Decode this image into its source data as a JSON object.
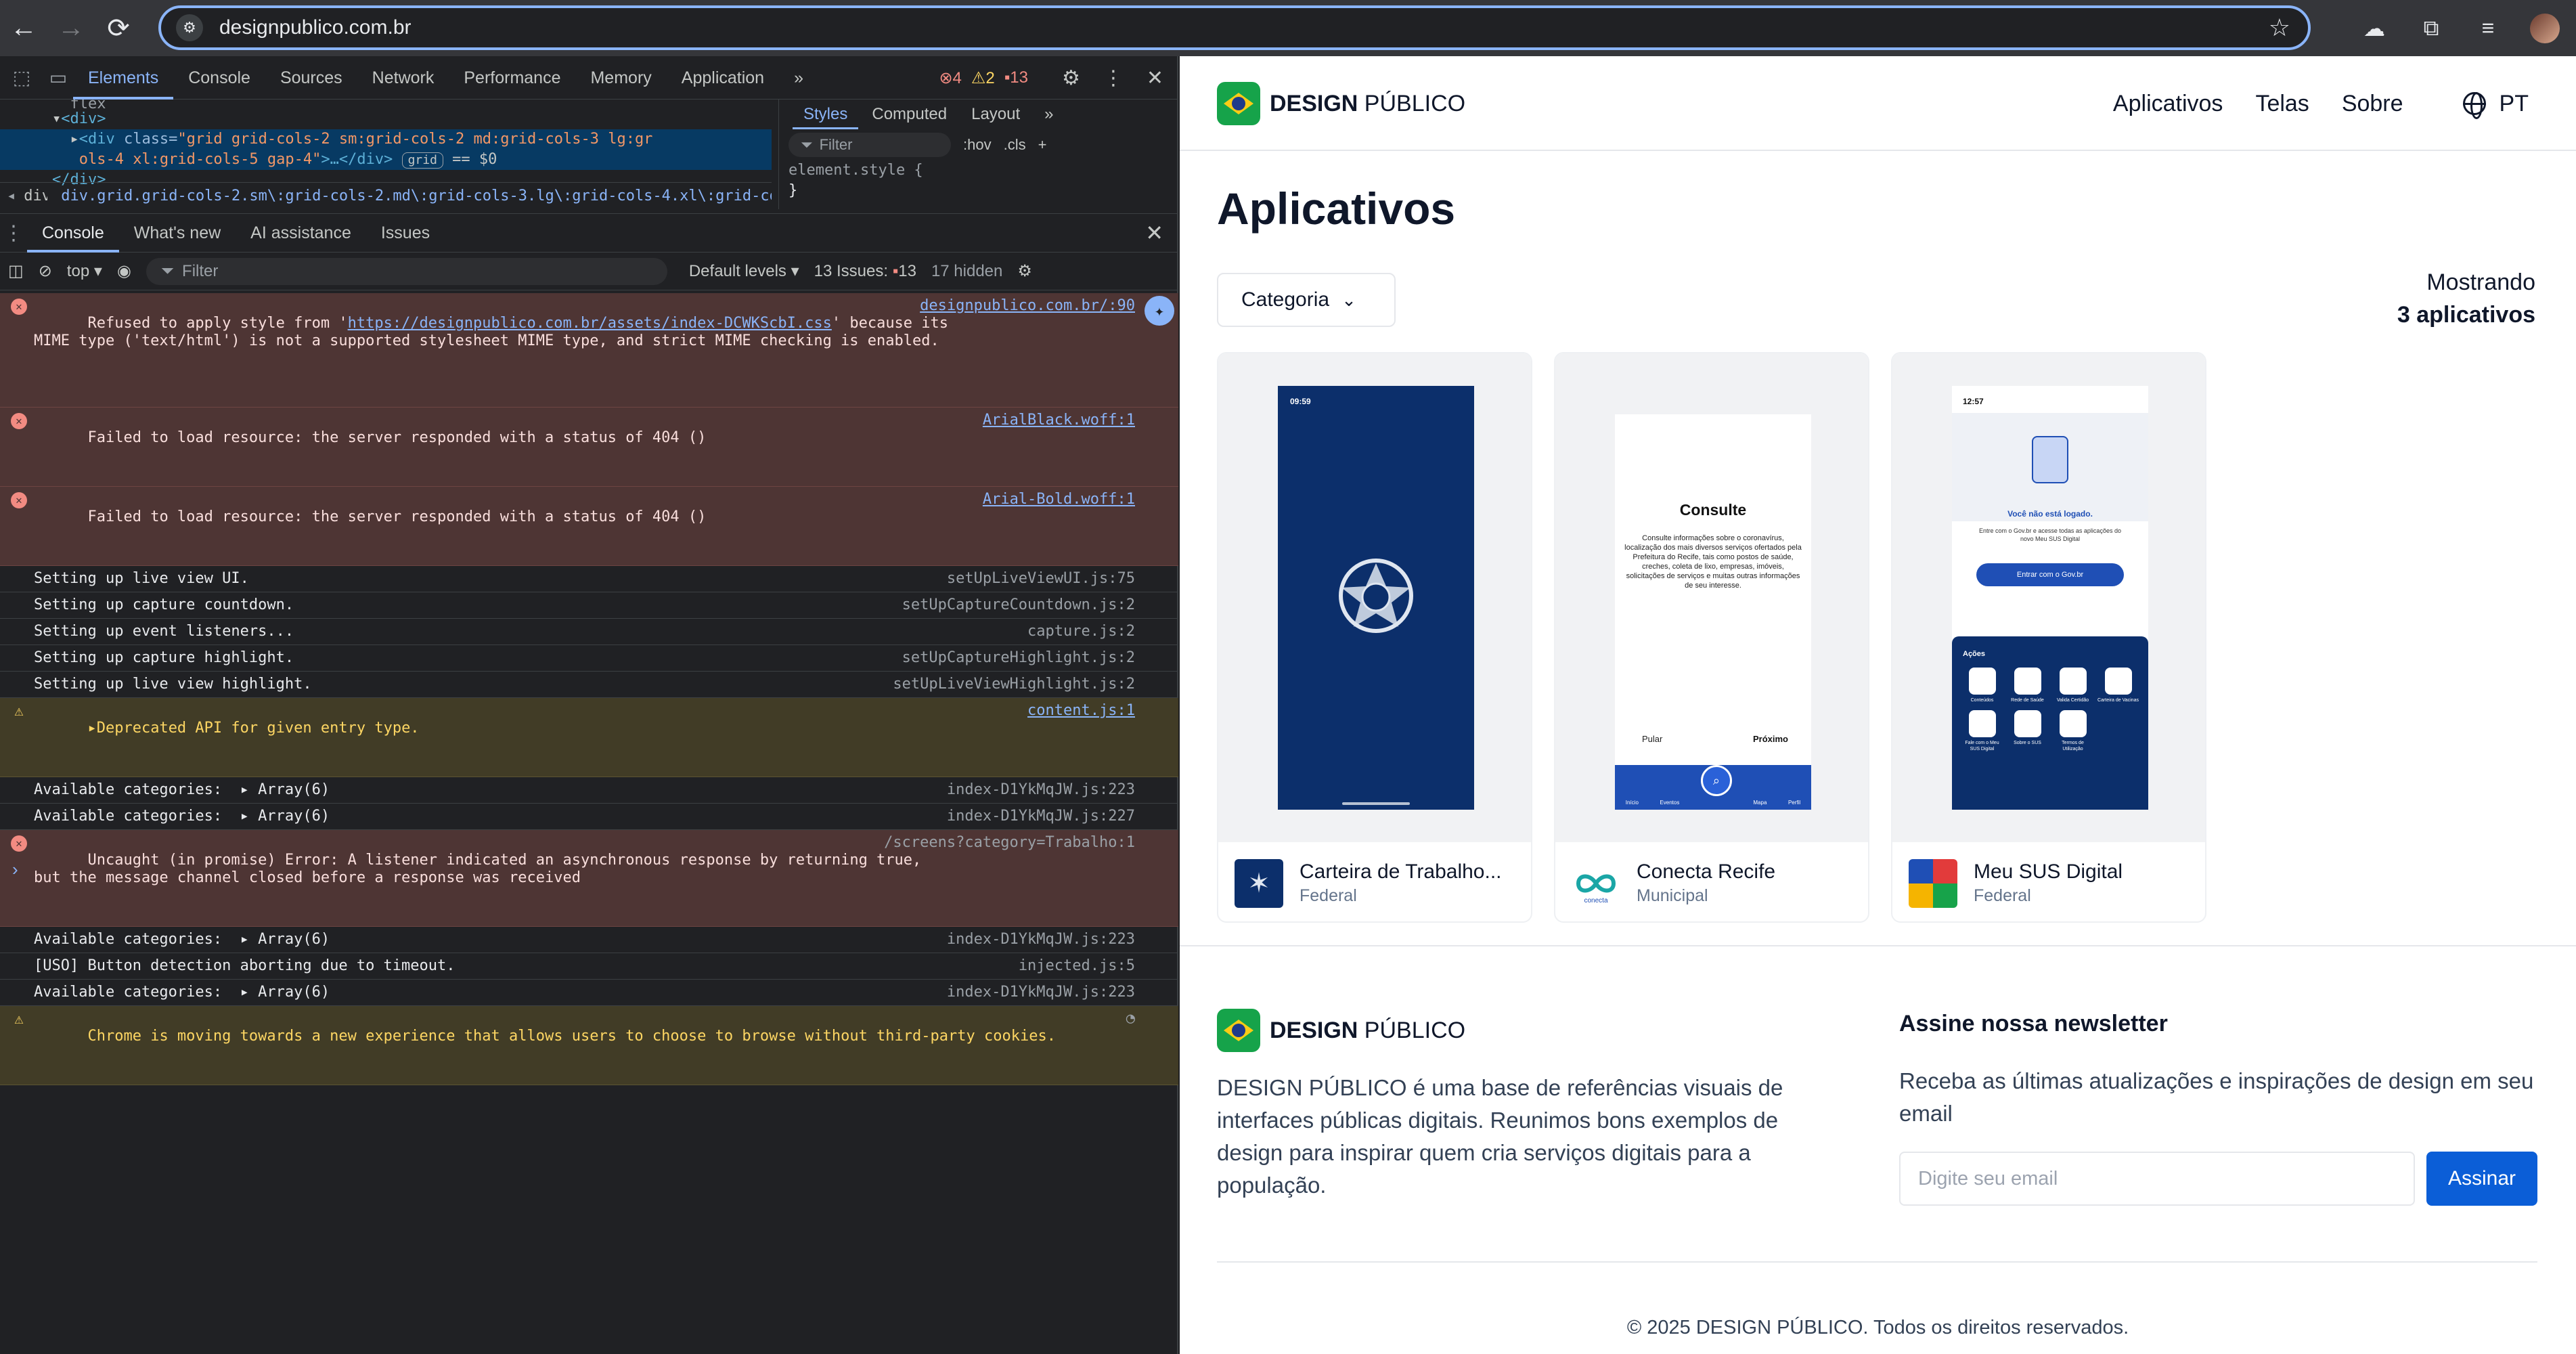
{
  "browser": {
    "url": "designpublico.com.br",
    "icons": [
      "back-icon",
      "forward-icon",
      "reload-icon",
      "site-info-icon",
      "star-icon",
      "cloud-icon",
      "extensions-icon",
      "media-icon",
      "profile-avatar"
    ]
  },
  "devtools": {
    "tabs": [
      "Elements",
      "Console",
      "Sources",
      "Network",
      "Performance",
      "Memory",
      "Application"
    ],
    "active_tab": "Elements",
    "more": "»",
    "badges": {
      "errors": "4",
      "warnings": "2",
      "issues": "13"
    },
    "elements": {
      "line_partial": "flex",
      "line1": "<div>",
      "line2_tag": "<div ",
      "line2_attr": "class=",
      "line2_val": "\"grid grid-cols-2 sm:grid-cols-2 md:grid-cols-3 lg:gr",
      "line3_val": "ols-4 xl:grid-cols-5 gap-4\"",
      "line3_rest": ">…</div>",
      "grid_pill": "grid",
      "eq": "== $0",
      "line4": "</div>",
      "breadcrumb_prefix": "div",
      "breadcrumb": "div.grid.grid-cols-2.sm\\:grid-cols-2.md\\:grid-cols-3.lg\\:grid-cols-4.xl\\:grid-cols-5.gap-4"
    },
    "styles": {
      "tabs": [
        "Styles",
        "Computed",
        "Layout"
      ],
      "more": "»",
      "filter_placeholder": "Filter",
      "hov": ":hov",
      "cls": ".cls",
      "code1": "element.style {",
      "code2": "}"
    },
    "drawer": {
      "tabs": [
        "Console",
        "What's new",
        "AI assistance",
        "Issues"
      ],
      "active_tab": "Console"
    },
    "console_toolbar": {
      "context": "top",
      "filter_placeholder": "Filter",
      "levels": "Default levels",
      "issues": "13 Issues:",
      "issues_count": "13",
      "hidden": "17 hidden"
    },
    "logs": [
      {
        "level": "error",
        "text1": "Refused to apply style from '",
        "link": "https://designpublico.com.br/assets/index-DCWKScbI.css",
        "text2": "' because its\nMIME type ('text/html') is not a supported stylesheet MIME type, and strict MIME checking is enabled.",
        "source": "designpublico.com.br/:90"
      },
      {
        "level": "error",
        "text": "Failed to load resource: the server responded with a status of 404 ()",
        "source": "ArialBlack.woff:1"
      },
      {
        "level": "error",
        "text": "Failed to load resource: the server responded with a status of 404 ()",
        "source": "Arial-Bold.woff:1"
      },
      {
        "level": "info",
        "text": "Setting up live view UI.",
        "source": "setUpLiveViewUI.js:75"
      },
      {
        "level": "info",
        "text": "Setting up capture countdown.",
        "source": "setUpCaptureCountdown.js:2"
      },
      {
        "level": "info",
        "text": "Setting up event listeners...",
        "source": "capture.js:2"
      },
      {
        "level": "info",
        "text": "Setting up capture highlight.",
        "source": "setUpCaptureHighlight.js:2"
      },
      {
        "level": "info",
        "text": "Setting up live view highlight.",
        "source": "setUpLiveViewHighlight.js:2"
      },
      {
        "level": "warning",
        "text": "▸Deprecated API for given entry type.",
        "source": "content.js:1"
      },
      {
        "level": "info",
        "text": "Available categories:",
        "array": "▸ Array(6)",
        "source": "index-D1YkMqJW.js:223"
      },
      {
        "level": "info",
        "text": "Available categories:",
        "array": "▸ Array(6)",
        "source": "index-D1YkMqJW.js:227"
      },
      {
        "level": "error",
        "text": "Uncaught (in promise) Error: A listener indicated an asynchronous response by returning true,\nbut the message channel closed before a response was received",
        "source": "/screens?category=Trabalho:1"
      },
      {
        "level": "info",
        "text": "Available categories:",
        "array": "▸ Array(6)",
        "source": "index-D1YkMqJW.js:223"
      },
      {
        "level": "info",
        "text": "[USO] Button detection aborting due to timeout.",
        "source": "injected.js:5"
      },
      {
        "level": "info",
        "text": "Available categories:",
        "array": "▸ Array(6)",
        "source": "index-D1YkMqJW.js:223"
      },
      {
        "level": "warning",
        "text": "Chrome is moving towards a new experience that allows users to choose to browse without third-party cookies.",
        "source": ""
      }
    ],
    "prompt": "›"
  },
  "site": {
    "brand_bold": "DESIGN",
    "brand_rest": " PÚBLICO",
    "nav": [
      "Aplicativos",
      "Telas",
      "Sobre"
    ],
    "lang": "PT",
    "title": "Aplicativos",
    "category_button": "Categoria",
    "count_line1": "Mostrando",
    "count_line2": "3 aplicativos",
    "apps": [
      {
        "name": "Carteira de Trabalho...",
        "category": "Federal",
        "phone_time": "09:59"
      },
      {
        "name": "Conecta Recife",
        "category": "Municipal",
        "screen_title": "Consulte",
        "screen_body": "Consulte informações sobre o coronavírus, localização dos mais diversos serviços ofertados pela Prefeitura do Recife, tais como postos de saúde, creches, coleta de lixo, empresas, imóveis, solicitações de serviços e muitas outras informações de seu interesse.",
        "skip": "Pular",
        "next": "Próximo",
        "tabbar": [
          "Início",
          "Eventos",
          "",
          "Mapa",
          "Perfil"
        ]
      },
      {
        "name": "Meu SUS Digital",
        "category": "Federal",
        "phone_time": "12:57",
        "not_logged": "Você não está logado.",
        "login_text": "Entre com o Gov.br e acesse todas as aplicações do novo Meu SUS Digital",
        "login_button": "Entrar com o Gov.br",
        "actions_title": "Ações",
        "actions": [
          "Conteúdos",
          "Rede de Saúde",
          "Valida Certidão",
          "Carteira de Vacinas",
          "Fale com o Meu SUS Digital",
          "Sobre o SUS",
          "Termos de Utilização"
        ]
      }
    ],
    "footer": {
      "description": "DESIGN PÚBLICO é uma base de referências visuais de interfaces públicas digitais. Reunimos bons exemplos de design para inspirar quem cria serviços digitais para a população.",
      "newsletter_title": "Assine nossa newsletter",
      "newsletter_text": "Receba as últimas atualizações e inspirações de design em seu email",
      "email_placeholder": "Digite seu email",
      "subscribe": "Assinar",
      "copyright": "© 2025 DESIGN PÚBLICO. Todos os direitos reservados."
    }
  }
}
